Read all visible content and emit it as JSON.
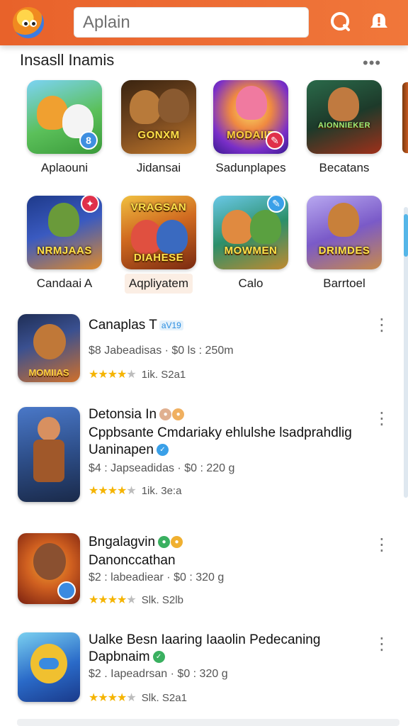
{
  "header": {
    "search_value": "Aplain",
    "logo_icon": "owl-logo-icon",
    "search_icon": "search-icon",
    "alert_icon": "alert-icon",
    "accent": "#ec6a32"
  },
  "section": {
    "title": "Insasll Inamis",
    "more": "•••"
  },
  "grid": [
    {
      "label": "Aplaouni",
      "art": "",
      "colors": [
        "#4fb848",
        "#3f9fe0"
      ],
      "badge_color": "#3f8fe0"
    },
    {
      "label": "Jidansai",
      "art": "GONXM",
      "colors": [
        "#4a2a10",
        "#c47a2a"
      ]
    },
    {
      "label": "Sadunplapes",
      "art": "MODAIIE",
      "colors": [
        "#6a2fc0",
        "#f0a040"
      ],
      "badge_color": "#e0304a"
    },
    {
      "label": "Becatans",
      "art": "AIONNIEKER",
      "colors": [
        "#1d5a3a",
        "#c0381e"
      ]
    },
    {
      "label": "Candaai A",
      "art": "NRMJAAS",
      "colors": [
        "#2a4fb0",
        "#e08a2a"
      ],
      "badge_color": "#e0304a"
    },
    {
      "label": "Aqpliyatem",
      "art": "DIAHESE",
      "colors": [
        "#b84a20",
        "#f0c040"
      ]
    },
    {
      "label": "Calo",
      "art": "MOWMEN",
      "colors": [
        "#2c8f6a",
        "#e0b040"
      ],
      "badge_color": "#3aa0e8"
    },
    {
      "label": "Barrtoel",
      "art": "DRIMDES",
      "colors": [
        "#7a5ac8",
        "#c88a4a"
      ]
    }
  ],
  "list": [
    {
      "title": "Canaplas T",
      "tag": "aV19",
      "extra_line": "",
      "extra_line2": "",
      "meta": "$8 Jabeadisas · $0 ls : 250m",
      "rating_text": "1ik. S2a1",
      "stars": 4,
      "art": "MOMIIAS",
      "colors": [
        "#2a3a60",
        "#d0702a"
      ]
    },
    {
      "title": "Detonsia In",
      "tag": "",
      "extra_line": "Cppbsante Cmdariaky ehlulshe lsadprahdlig",
      "extra_line2": "Uaninapen",
      "meta": "$4 : Japseadidas · $0 : 220 g",
      "rating_text": "1ik. 3e:a",
      "stars": 4,
      "art": "",
      "colors": [
        "#2e4f8a",
        "#c06a30"
      ]
    },
    {
      "title": "Bngalagvin",
      "tag": "",
      "extra_line": "Danonccathan",
      "extra_line2": "",
      "meta": "$2 : labeadiear · $0 : 320 g",
      "rating_text": "Slk. S2lb",
      "stars": 4,
      "art": "",
      "colors": [
        "#b0401a",
        "#f0a030"
      ]
    },
    {
      "title": "Ualke Besn  Iaaring Iaaolin Pedecaning",
      "tag": "",
      "extra_line": "Dapbnaim",
      "extra_line2": "",
      "meta": "$2 . Iapeadrsan · $0 : 320 g",
      "rating_text": "Slk. S2a1",
      "stars": 4,
      "art": "",
      "colors": [
        "#2a6ac8",
        "#7ad0f0"
      ]
    }
  ]
}
